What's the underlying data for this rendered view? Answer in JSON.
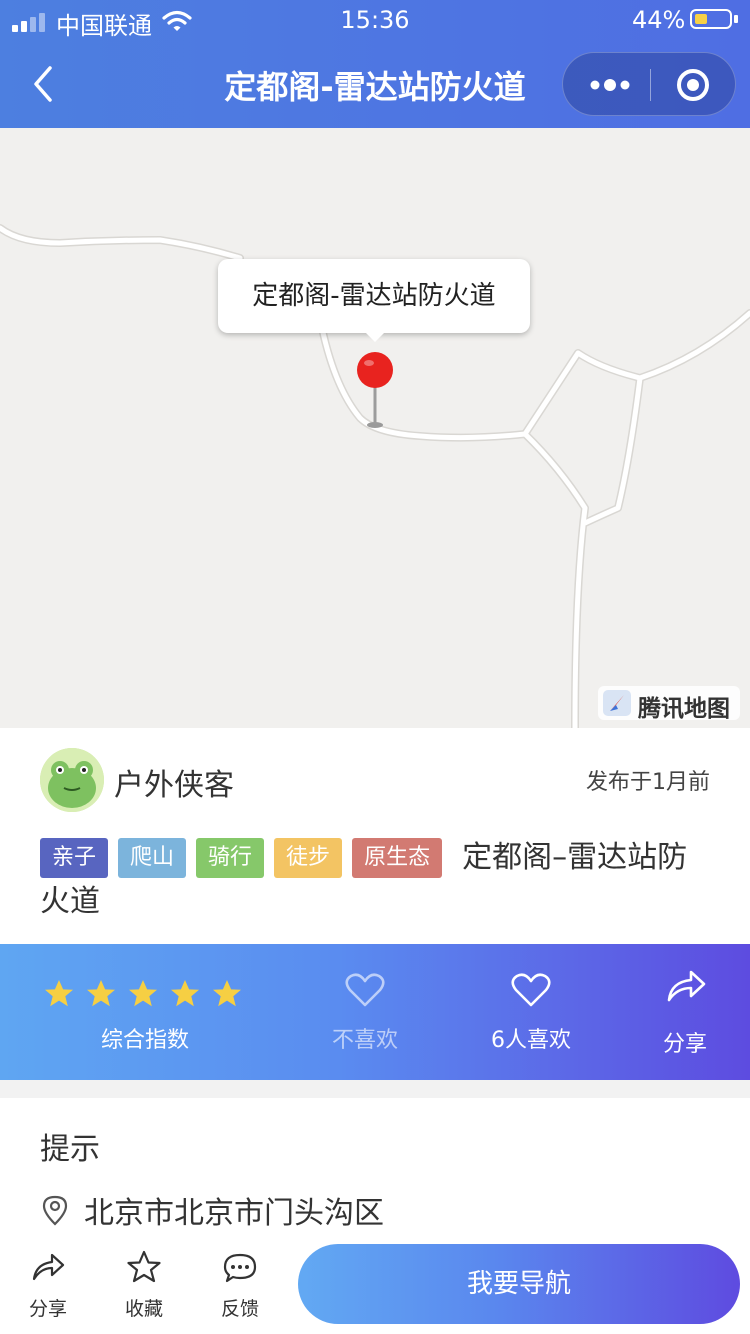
{
  "status_bar": {
    "carrier": "中国联通",
    "time": "15:36",
    "battery_percent": "44%",
    "battery_level": 0.44
  },
  "nav": {
    "title": "定都阁-雷达站防火道"
  },
  "map": {
    "callout": "定都阁-雷达站防火道",
    "provider_logo": "腾讯地图"
  },
  "author": {
    "name": "户外侠客",
    "publish_time": "发布于1月前"
  },
  "tags": [
    "亲子",
    "爬山",
    "骑行",
    "徒步",
    "原生态"
  ],
  "route_title": "定都阁–雷达站防火道",
  "rating": {
    "stars": 5,
    "label": "综合指数",
    "dislike_label": "不喜欢",
    "like_label": "6人喜欢",
    "share_label": "分享"
  },
  "tips": {
    "heading": "提示",
    "address": "北京市北京市门头沟区"
  },
  "bottom_bar": {
    "share": "分享",
    "favorite": "收藏",
    "feedback": "反馈",
    "navigate": "我要导航"
  },
  "colors": {
    "header": "#4d7fe0",
    "tag_purple": "#5865c0",
    "tag_blue": "#7cb4dc",
    "tag_green": "#86c86a",
    "tag_yellow": "#f3c463",
    "tag_red": "#d27a72",
    "star": "#f6cf43",
    "pin": "#e8231f"
  }
}
